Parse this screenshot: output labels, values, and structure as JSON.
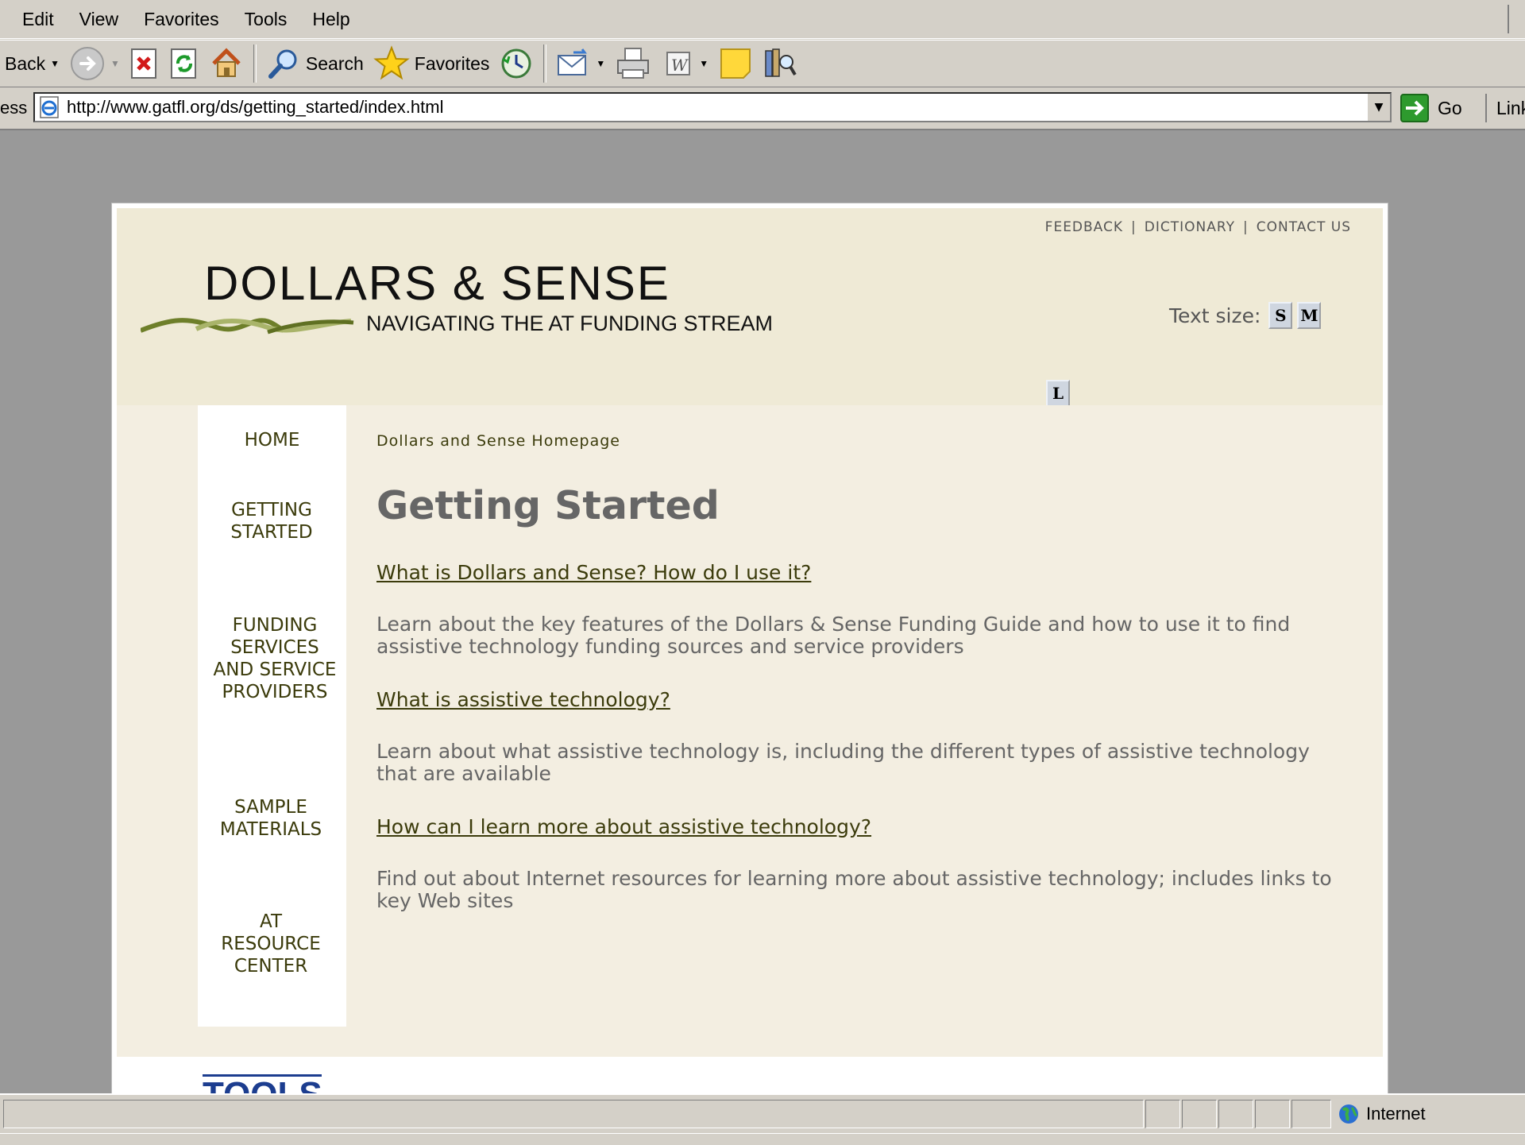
{
  "browser": {
    "menu": [
      "Edit",
      "View",
      "Favorites",
      "Tools",
      "Help"
    ],
    "toolbar": {
      "back_label": "Back",
      "search_label": "Search",
      "favorites_label": "Favorites"
    },
    "address": {
      "label": "ess",
      "url": "http://www.gatfl.org/ds/getting_started/index.html",
      "go_label": "Go",
      "links_label": "Link"
    },
    "status": {
      "zone": "Internet"
    }
  },
  "site": {
    "utility_links": [
      "FEEDBACK",
      "DICTIONARY",
      "CONTACT US"
    ],
    "logo_title": "DOLLARS & SENSE",
    "logo_subtitle": "NAVIGATING THE AT FUNDING STREAM",
    "text_size_label": "Text size:",
    "text_size_buttons": [
      "S",
      "M",
      "L"
    ],
    "nav": [
      {
        "label": "HOME"
      },
      {
        "label": "GETTING STARTED"
      },
      {
        "label": "FUNDING SERVICES AND SERVICE PROVIDERS"
      },
      {
        "label": "SAMPLE MATERIALS"
      },
      {
        "label": "AT RESOURCE CENTER"
      }
    ],
    "breadcrumb": "Dollars and Sense Homepage",
    "page_title": "Getting Started",
    "sections": [
      {
        "link": "What is Dollars and Sense? How do I use it?",
        "description": "Learn about the key features of the Dollars & Sense Funding Guide and how to use it to find assistive technology funding sources and service providers"
      },
      {
        "link": "What is assistive technology?",
        "description": "Learn about what assistive technology is, including the different types of assistive technology that are available"
      },
      {
        "link": "How can I learn more about assistive technology?",
        "description": "Find out about Internet resources for learning more about assistive technology; includes links to key Web sites"
      }
    ],
    "footer_logo_text": "TOOLS"
  },
  "colors": {
    "header_bg": "#efead6",
    "content_bg": "#f3eee1",
    "nav_text": "#3b3b0b",
    "body_text": "#666666",
    "viewport_bg": "#999999"
  }
}
